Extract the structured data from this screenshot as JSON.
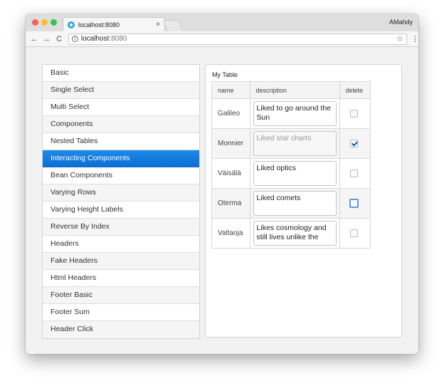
{
  "browser": {
    "tab_title": "localhost:8080",
    "tab_close": "×",
    "profile_name": "AMahdy",
    "nav_back": "←",
    "nav_forward": "→",
    "nav_reload": "C",
    "info_glyph": "i",
    "url_host": "localhost",
    "url_port": ":8080",
    "star_glyph": "☆",
    "menu_glyph": "⋮"
  },
  "sidebar": {
    "items": [
      {
        "label": "Basic",
        "active": false
      },
      {
        "label": "Single Select",
        "active": false
      },
      {
        "label": "Multi Select",
        "active": false
      },
      {
        "label": "Components",
        "active": false
      },
      {
        "label": "Nested Tables",
        "active": false
      },
      {
        "label": "Interacting Components",
        "active": true
      },
      {
        "label": "Bean Components",
        "active": false
      },
      {
        "label": "Varying Rows",
        "active": false
      },
      {
        "label": "Varying Height Labels",
        "active": false
      },
      {
        "label": "Reverse By Index",
        "active": false
      },
      {
        "label": "Headers",
        "active": false
      },
      {
        "label": "Fake Headers",
        "active": false
      },
      {
        "label": "Html Headers",
        "active": false
      },
      {
        "label": "Footer Basic",
        "active": false
      },
      {
        "label": "Footer Sum",
        "active": false
      },
      {
        "label": "Header Click",
        "active": false
      }
    ]
  },
  "panel": {
    "title": "My Table",
    "columns": [
      "name",
      "description",
      "delete"
    ],
    "rows": [
      {
        "name": "Galileo",
        "description": "Liked to go around the Sun",
        "delete": false,
        "disabled": false
      },
      {
        "name": "Monnier",
        "description": "Liked star charts",
        "delete": true,
        "disabled": true
      },
      {
        "name": "Väisälä",
        "description": "Liked optics",
        "delete": false,
        "disabled": false
      },
      {
        "name": "Oterma",
        "description": "Liked comets",
        "delete": false,
        "disabled": false
      },
      {
        "name": "Valtaoja",
        "description": "Likes cosmology and still lives unlike the",
        "delete": false,
        "disabled": false
      }
    ]
  },
  "colors": {
    "active_item": "#0c6fd3",
    "favicon": "#2ea8e0",
    "checkbox_focus": "#5b9be5"
  }
}
